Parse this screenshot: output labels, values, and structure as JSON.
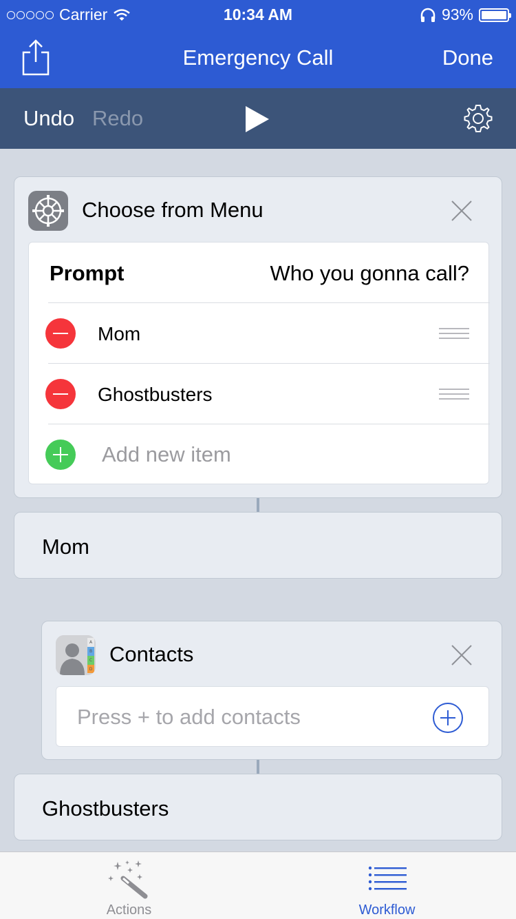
{
  "status_bar": {
    "carrier": "Carrier",
    "time": "10:34 AM",
    "battery": "93%"
  },
  "nav": {
    "title": "Emergency Call",
    "done_label": "Done"
  },
  "toolbar": {
    "undo_label": "Undo",
    "redo_label": "Redo"
  },
  "menu_action": {
    "title": "Choose from Menu",
    "prompt_label": "Prompt",
    "prompt_value": "Who you gonna call?",
    "items": [
      {
        "label": "Mom"
      },
      {
        "label": "Ghostbusters"
      }
    ],
    "add_item_placeholder": "Add new item"
  },
  "flow": {
    "mom_label": "Mom",
    "ghostbusters_label": "Ghostbusters"
  },
  "contacts_action": {
    "title": "Contacts",
    "placeholder": "Press + to add contacts",
    "index_letters": [
      "A",
      "B",
      "C",
      "D"
    ]
  },
  "tab_bar": {
    "actions_label": "Actions",
    "workflow_label": "Workflow"
  },
  "colors": {
    "nav_blue": "#2d5bd3",
    "toolbar_navy": "#3c5479",
    "remove_red": "#f5353b",
    "add_green": "#45cb58"
  }
}
